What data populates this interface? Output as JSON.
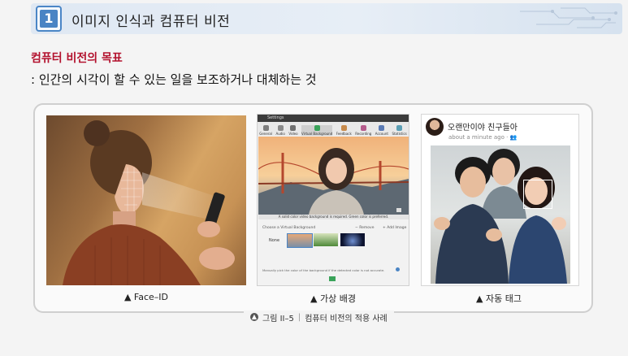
{
  "header": {
    "number": "1",
    "title": "이미지 인식과 컴퓨터 비전"
  },
  "section": {
    "title": "컴퓨터 비전의 목표",
    "description": ": 인간의 시각이 할 수 있는 일을 보조하거나 대체하는 것"
  },
  "panels": [
    {
      "caption": "▲ Face–ID"
    },
    {
      "caption": "▲ 가상 배경"
    },
    {
      "caption": "▲ 자동 태그"
    }
  ],
  "settings_window": {
    "title": "Settings",
    "tabs": [
      "General",
      "Audio",
      "Video",
      "Virtual Background",
      "Feedback",
      "Recording",
      "Account",
      "Statistics"
    ],
    "notice": "A solid color video background is required. Green color is preferred.",
    "choose_label": "Choose a Virtual Background",
    "remove_label": "− Remove",
    "add_image_label": "+ Add Image",
    "none_label": "None",
    "footnote": "Manually pick the color of the background if the detected color is not accurate."
  },
  "social_post": {
    "name": "오랜만이야 친구들아",
    "time": "about a minute ago ·"
  },
  "figure_caption": {
    "label": "그림 II–5",
    "separator": "|",
    "text": "컴퓨터 비전의 적용 사례"
  },
  "colors": {
    "accent_red": "#b3122e",
    "header_blue": "#4a84c4"
  }
}
